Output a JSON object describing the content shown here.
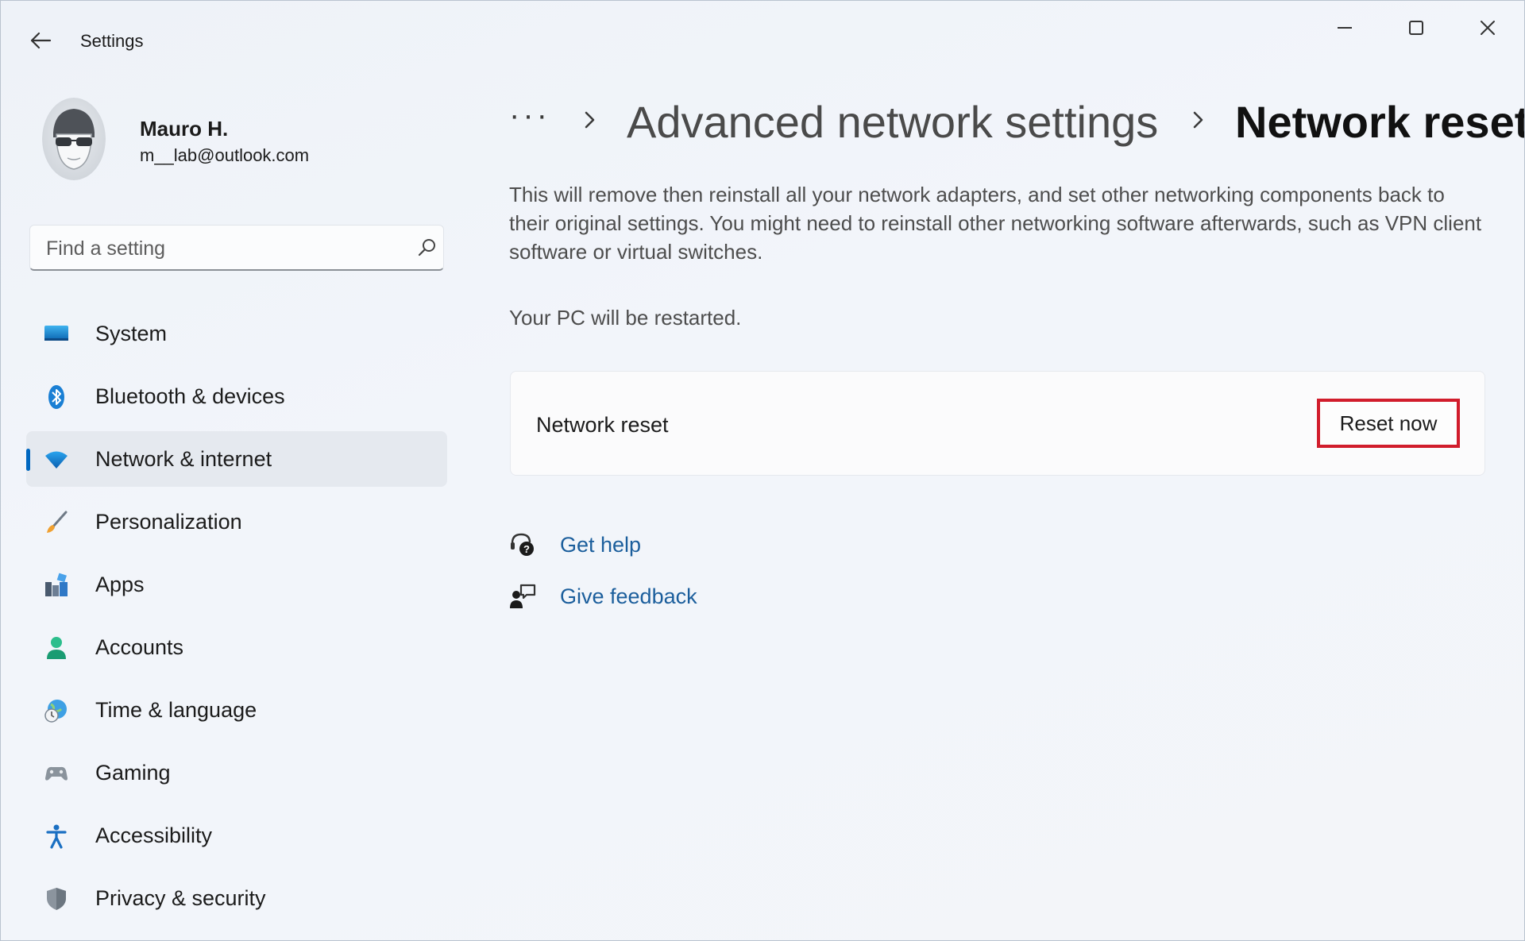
{
  "window": {
    "title": "Settings"
  },
  "profile": {
    "name": "Mauro H.",
    "email": "m__lab@outlook.com"
  },
  "search": {
    "placeholder": "Find a setting"
  },
  "nav": {
    "items": [
      {
        "label": "System",
        "icon": "monitor-icon"
      },
      {
        "label": "Bluetooth & devices",
        "icon": "bluetooth-icon"
      },
      {
        "label": "Network & internet",
        "icon": "wifi-icon",
        "active": true
      },
      {
        "label": "Personalization",
        "icon": "brush-icon"
      },
      {
        "label": "Apps",
        "icon": "apps-icon"
      },
      {
        "label": "Accounts",
        "icon": "person-icon"
      },
      {
        "label": "Time & language",
        "icon": "globe-clock-icon"
      },
      {
        "label": "Gaming",
        "icon": "gamepad-icon"
      },
      {
        "label": "Accessibility",
        "icon": "accessibility-icon"
      },
      {
        "label": "Privacy & security",
        "icon": "shield-icon"
      }
    ]
  },
  "breadcrumb": {
    "more": "···",
    "parent": "Advanced network settings",
    "current": "Network reset"
  },
  "main": {
    "description": "This will remove then reinstall all your network adapters, and set other networking components back to their original settings. You might need to reinstall other networking software afterwards, such as VPN client software or virtual switches.",
    "restart_note": "Your PC will be restarted.",
    "card": {
      "label": "Network reset",
      "button": "Reset now"
    },
    "links": {
      "help": "Get help",
      "feedback": "Give feedback"
    }
  },
  "colors": {
    "accent": "#0067c0",
    "highlight_border": "#d11d2c",
    "link": "#1b5e9c"
  }
}
